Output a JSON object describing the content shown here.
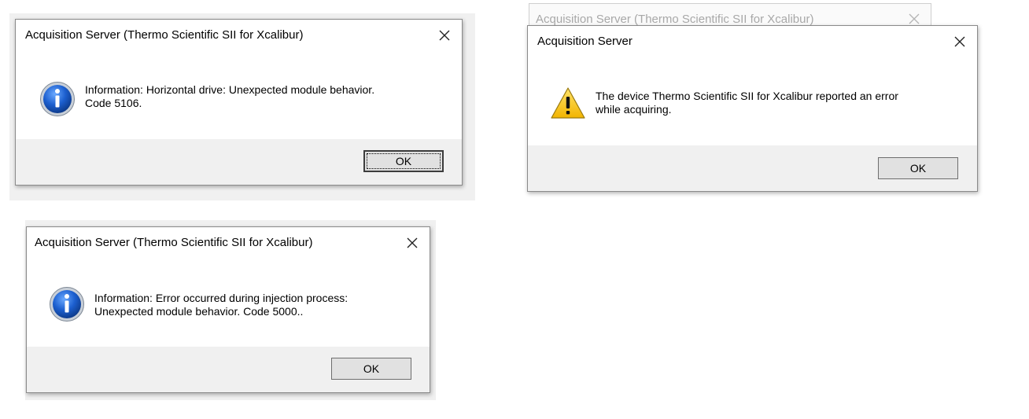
{
  "dialog1": {
    "title": "Acquisition Server (Thermo Scientific SII for Xcalibur)",
    "icon": "information-icon",
    "message_line1": "Information: Horizontal drive: Unexpected module behavior.",
    "message_line2": "Code 5106.",
    "ok_label": "OK"
  },
  "dialog2": {
    "background_title": "Acquisition Server (Thermo Scientific SII for Xcalibur)",
    "title": "Acquisition Server",
    "icon": "warning-icon",
    "message_line1": "The device Thermo Scientific SII for Xcalibur reported an error",
    "message_line2": "while acquiring.",
    "ok_label": "OK"
  },
  "dialog3": {
    "title": "Acquisition Server (Thermo Scientific SII for Xcalibur)",
    "icon": "information-icon",
    "message_line1": "Information: Error occurred during injection process:",
    "message_line2": "Unexpected module behavior. Code 5000..",
    "ok_label": "OK"
  },
  "colors": {
    "info_blue": "#1c5fcf",
    "warning_yellow": "#f7c31b",
    "button_face": "#e1e1e1",
    "dialog_footer": "#f0f0f0"
  }
}
